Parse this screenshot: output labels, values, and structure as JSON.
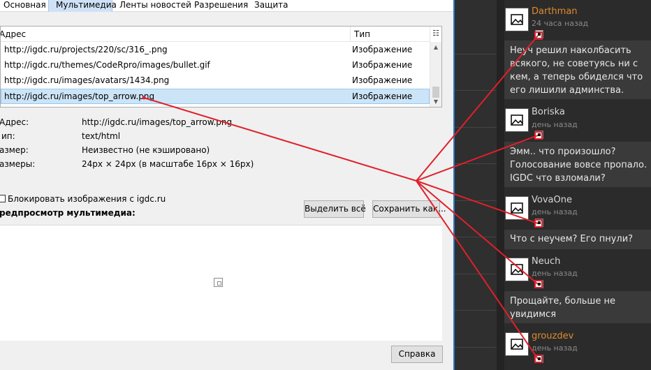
{
  "dialog": {
    "tabs": [
      "Основная",
      "Мультимедиа",
      "Ленты новостей",
      "Разрешения",
      "Защита"
    ],
    "list": {
      "col_address": "Адрес",
      "col_type": "Тип",
      "rows": [
        {
          "address": "http://igdc.ru/projects/220/sc/316_.png",
          "type": "Изображение"
        },
        {
          "address": "http://igdc.ru/themes/CodeRpro/images/bullet.gif",
          "type": "Изображение"
        },
        {
          "address": "http://igdc.ru/images/avatars/1434.png",
          "type": "Изображение"
        },
        {
          "address": "http://igdc.ru/images/top_arrow.png",
          "type": "Изображение"
        }
      ]
    },
    "props": {
      "address_label": "Адрес:",
      "address_value": "http://igdc.ru/images/top_arrow.png",
      "type_label": "ип:",
      "type_value": "text/html",
      "size_label": "азмер:",
      "size_value": "Неизвестно (не кэшировано)",
      "dims_label": "азмеры:",
      "dims_value": "24px × 24px (в масштабе 16px × 16px)"
    },
    "block_images_label": "Блокировать изображения с igdc.ru",
    "preview_label": "редпросмотр мультимедиа:",
    "select_all": "Выделить всё",
    "save_as": "Сохранить как...",
    "help": "Справка"
  },
  "feed": {
    "comments": [
      {
        "user": "Darthman",
        "time": "24 часа назад",
        "text": "Неуч решил наколбасить всякого, не советуясь ни с кем, а теперь обиделся что его лишили админства.",
        "highlight": true
      },
      {
        "user": "Boriska",
        "time": "день назад",
        "text": "Эмм.. что произошло? Голосование вовсе пропало. IGDC что взломали?",
        "highlight": false
      },
      {
        "user": "VovaOne",
        "time": "день назад",
        "text": "Что с неучем? Его пнули?",
        "highlight": false
      },
      {
        "user": "Neuch",
        "time": "день назад",
        "text": "Прощайте, больше не увидимся",
        "highlight": false
      },
      {
        "user": "grouzdev",
        "time": "день назад",
        "text": "",
        "highlight": true
      }
    ]
  },
  "colors": {
    "arrow": "#e0202a",
    "username_highlight": "#e08a2e",
    "selection": "#cce4f7",
    "dialog_bg": "#f0f0f0",
    "feed_bg": "#2b2b2b"
  }
}
